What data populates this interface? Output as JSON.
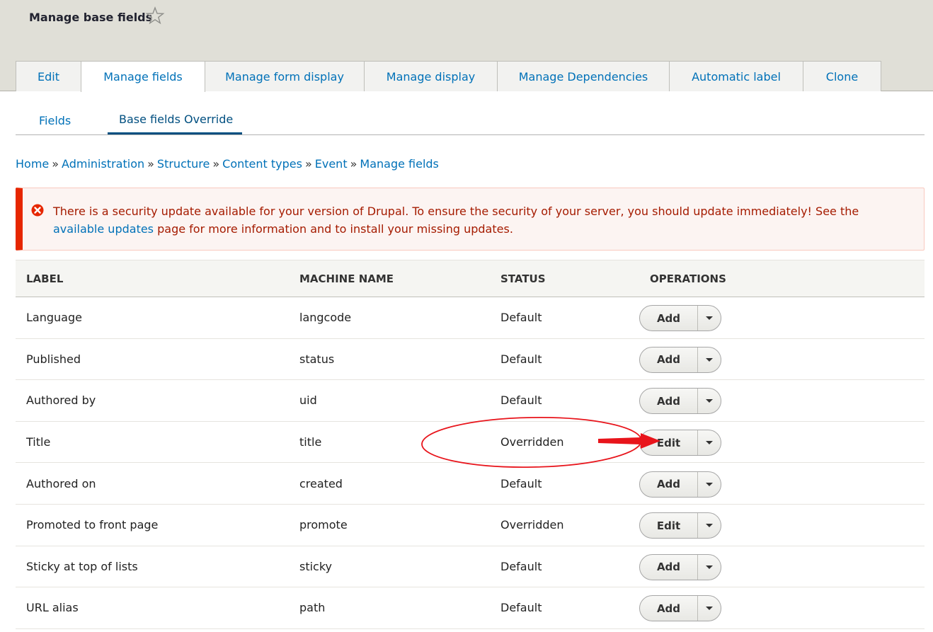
{
  "header": {
    "title": "Manage base fields"
  },
  "tabs": [
    {
      "label": "Edit"
    },
    {
      "label": "Manage fields"
    },
    {
      "label": "Manage form display"
    },
    {
      "label": "Manage display"
    },
    {
      "label": "Manage Dependencies"
    },
    {
      "label": "Automatic label"
    },
    {
      "label": "Clone"
    }
  ],
  "subtabs": [
    {
      "label": "Fields"
    },
    {
      "label": "Base fields Override"
    }
  ],
  "breadcrumb": [
    {
      "label": "Home"
    },
    {
      "label": "Administration"
    },
    {
      "label": "Structure"
    },
    {
      "label": "Content types"
    },
    {
      "label": "Event"
    },
    {
      "label": "Manage fields"
    }
  ],
  "breadcrumb_separator": "»",
  "alert": {
    "text_before": "There is a security update available for your version of Drupal. To ensure the security of your server, you should update immediately! See the ",
    "link": "available updates",
    "text_after": " page for more information and to install your missing updates."
  },
  "table": {
    "headers": [
      "LABEL",
      "MACHINE NAME",
      "STATUS",
      "OPERATIONS"
    ],
    "rows": [
      {
        "label": "Language",
        "machine": "langcode",
        "status": "Default",
        "op": "Add"
      },
      {
        "label": "Published",
        "machine": "status",
        "status": "Default",
        "op": "Add"
      },
      {
        "label": "Authored by",
        "machine": "uid",
        "status": "Default",
        "op": "Add"
      },
      {
        "label": "Title",
        "machine": "title",
        "status": "Overridden",
        "op": "Edit"
      },
      {
        "label": "Authored on",
        "machine": "created",
        "status": "Default",
        "op": "Add"
      },
      {
        "label": "Promoted to front page",
        "machine": "promote",
        "status": "Overridden",
        "op": "Edit"
      },
      {
        "label": "Sticky at top of lists",
        "machine": "sticky",
        "status": "Default",
        "op": "Add"
      },
      {
        "label": "URL alias",
        "machine": "path",
        "status": "Default",
        "op": "Add"
      }
    ]
  },
  "colors": {
    "link": "#0071b8",
    "error": "#e62600",
    "annotation": "#e8141b"
  }
}
